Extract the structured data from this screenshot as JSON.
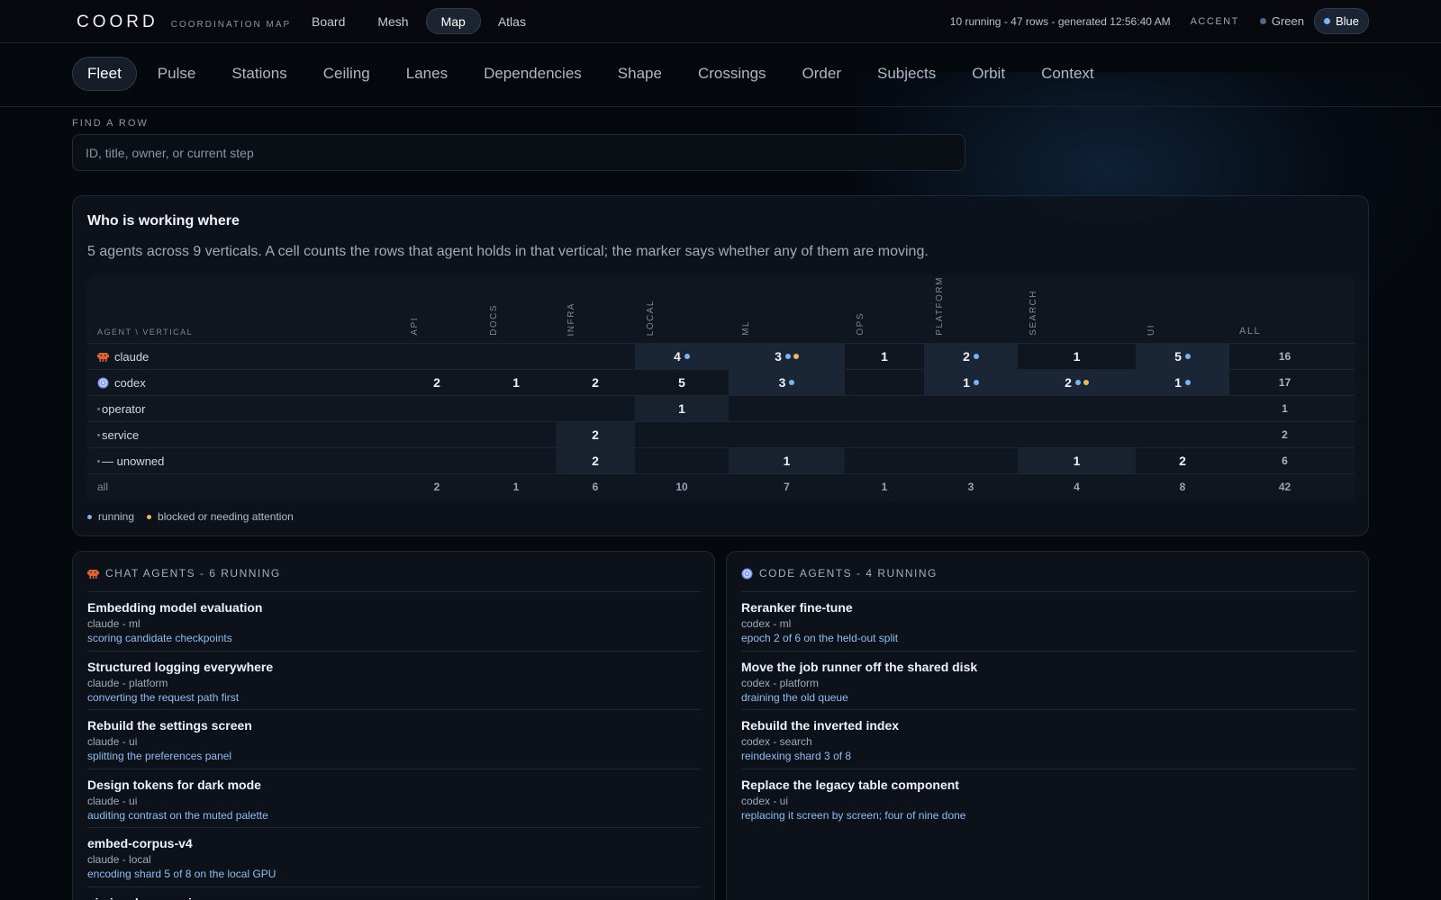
{
  "app": {
    "brand": "COORD",
    "brand_sub": "COORDINATION MAP",
    "nav": [
      "Board",
      "Mesh",
      "Map",
      "Atlas"
    ],
    "nav_active": "Map",
    "status": "10 running - 47 rows - generated 12:56:40 AM",
    "accent_label": "ACCENT",
    "accents": [
      "Green",
      "Blue"
    ],
    "accent_active": "Blue"
  },
  "tabs": [
    "Fleet",
    "Pulse",
    "Stations",
    "Ceiling",
    "Lanes",
    "Dependencies",
    "Shape",
    "Crossings",
    "Order",
    "Subjects",
    "Orbit",
    "Context"
  ],
  "tab_active": "Fleet",
  "search": {
    "label": "FIND A ROW",
    "placeholder": "ID, title, owner, or current step"
  },
  "matrix": {
    "title": "Who is working where",
    "description": "5 agents across 9 verticals. A cell counts the rows that agent holds in that vertical; the marker says whether any of them are moving.",
    "axis_label": "AGENT \\ VERTICAL",
    "columns": [
      "API",
      "DOCS",
      "INFRA",
      "LOCAL",
      "ML",
      "OPS",
      "PLATFORM",
      "SEARCH",
      "UI"
    ],
    "all_label": "ALL",
    "rows": [
      {
        "agent": "claude",
        "icon": "claude-icon",
        "cells": [
          null,
          null,
          null,
          {
            "v": "4",
            "m": [
              "run"
            ]
          },
          {
            "v": "3",
            "m": [
              "run",
              "block"
            ]
          },
          {
            "v": "1",
            "m": []
          },
          {
            "v": "2",
            "m": [
              "run"
            ]
          },
          {
            "v": "1",
            "m": []
          },
          {
            "v": "5",
            "m": [
              "run"
            ]
          }
        ],
        "total": "16"
      },
      {
        "agent": "codex",
        "icon": "codex-icon",
        "cells": [
          {
            "v": "2",
            "m": []
          },
          {
            "v": "1",
            "m": []
          },
          {
            "v": "2",
            "m": []
          },
          {
            "v": "5",
            "m": []
          },
          {
            "v": "3",
            "m": [
              "run"
            ]
          },
          null,
          {
            "v": "1",
            "m": [
              "run"
            ]
          },
          {
            "v": "2",
            "m": [
              "run",
              "block"
            ]
          },
          {
            "v": "1",
            "m": [
              "run"
            ]
          }
        ],
        "total": "17"
      },
      {
        "agent": "operator",
        "icon": "dot",
        "cells": [
          null,
          null,
          null,
          {
            "v": "1",
            "m": []
          },
          null,
          null,
          null,
          null,
          null
        ],
        "total": "1"
      },
      {
        "agent": "service",
        "icon": "dot",
        "cells": [
          null,
          null,
          {
            "v": "2",
            "m": []
          },
          null,
          null,
          null,
          null,
          null,
          null
        ],
        "total": "2"
      },
      {
        "agent": "— unowned",
        "icon": "dot",
        "cells": [
          null,
          null,
          {
            "v": "2",
            "m": []
          },
          null,
          {
            "v": "1",
            "m": []
          },
          null,
          null,
          {
            "v": "1",
            "m": []
          },
          {
            "v": "2",
            "m": []
          }
        ],
        "total": "6"
      }
    ],
    "all_row": {
      "label": "all",
      "values": [
        "2",
        "1",
        "6",
        "10",
        "7",
        "1",
        "3",
        "4",
        "8"
      ],
      "total": "42"
    },
    "legend": {
      "running": "running",
      "blocked": "blocked or needing attention"
    }
  },
  "chat_agents": {
    "heading": "CHAT AGENTS - 6 RUNNING",
    "items": [
      {
        "title": "Embedding model evaluation",
        "meta": "claude - ml",
        "step": "scoring candidate checkpoints"
      },
      {
        "title": "Structured logging everywhere",
        "meta": "claude - platform",
        "step": "converting the request path first"
      },
      {
        "title": "Rebuild the settings screen",
        "meta": "claude - ui",
        "step": "splitting the preferences panel"
      },
      {
        "title": "Design tokens for dark mode",
        "meta": "claude - ui",
        "step": "auditing contrast on the muted palette"
      },
      {
        "title": "embed-corpus-v4",
        "meta": "claude - local",
        "step": "encoding shard 5 of 8 on the local GPU"
      },
      {
        "title": "ui-visual-regression",
        "meta": "",
        "step": ""
      }
    ]
  },
  "code_agents": {
    "heading": "CODE AGENTS - 4 RUNNING",
    "items": [
      {
        "title": "Reranker fine-tune",
        "meta": "codex - ml",
        "step": "epoch 2 of 6 on the held-out split"
      },
      {
        "title": "Move the job runner off the shared disk",
        "meta": "codex - platform",
        "step": "draining the old queue"
      },
      {
        "title": "Rebuild the inverted index",
        "meta": "codex - search",
        "step": "reindexing shard 3 of 8"
      },
      {
        "title": "Replace the legacy table component",
        "meta": "codex - ui",
        "step": "replacing it screen by screen; four of nine done"
      }
    ]
  },
  "colors": {
    "accent": "#7db3f5",
    "blocked": "#e8b964",
    "claude_icon": "#e0623a",
    "codex_icon": "#8aa2f0"
  }
}
